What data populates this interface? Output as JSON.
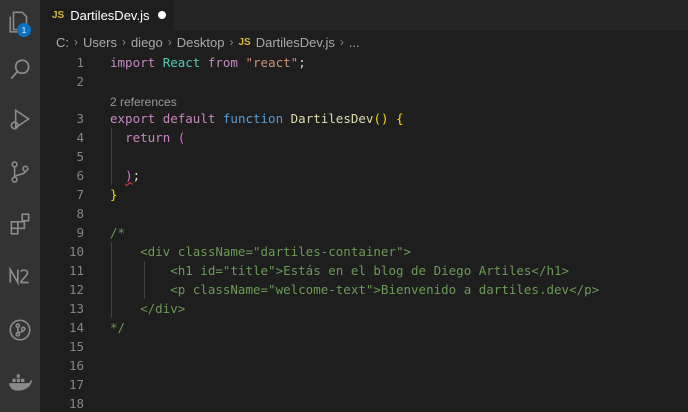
{
  "activity_bar": {
    "items": [
      {
        "name": "explorer-icon",
        "badge": "1"
      },
      {
        "name": "search-icon"
      },
      {
        "name": "run-debug-icon"
      },
      {
        "name": "source-control-icon"
      },
      {
        "name": "extensions-icon"
      },
      {
        "name": "n2-icon"
      },
      {
        "name": "git-graph-icon"
      },
      {
        "name": "docker-icon"
      }
    ]
  },
  "tab": {
    "lang": "JS",
    "label": "DartilesDev.js",
    "dirty": true
  },
  "breadcrumb": {
    "drive": "C:",
    "users": "Users",
    "user": "diego",
    "desktop": "Desktop",
    "lang": "JS",
    "file": "DartilesDev.js",
    "more": "..."
  },
  "editor": {
    "line_numbers": [
      "1",
      "2",
      "3",
      "4",
      "5",
      "6",
      "7",
      "8",
      "9",
      "10",
      "11",
      "12",
      "13",
      "14",
      "15",
      "16",
      "17",
      "18"
    ],
    "codelens": "2 references",
    "code": {
      "l1": {
        "import": "import",
        "react": "React",
        "from": "from",
        "str": "\"react\"",
        "semi": ";"
      },
      "l3": {
        "export": "export",
        "default": "default",
        "function": "function",
        "name": "DartilesDev",
        "parens": "()",
        "brace": "{"
      },
      "l4": {
        "return": "return",
        "paren": "("
      },
      "l6": {
        "close": ")",
        "semi": ";"
      },
      "l7": {
        "brace": "}"
      },
      "l9": "/*",
      "l10": "    <div className=\"dartiles-container\">",
      "l11": "        <h1 id=\"title\">Estás en el blog de Diego Artiles</h1>",
      "l12": "        <p className=\"welcome-text\">Bienvenido a dartiles.dev</p>",
      "l13": "    </div>",
      "l14": "*/"
    }
  },
  "colors": {
    "keyword_control": "#c586c0",
    "keyword": "#569cd6",
    "type": "#4ec9b0",
    "string": "#ce9178",
    "function": "#dcdcaa",
    "comment": "#6a9955",
    "bracket": "#ffd700",
    "js_tag": "#d7ba3d",
    "badge": "#0e70c0"
  }
}
